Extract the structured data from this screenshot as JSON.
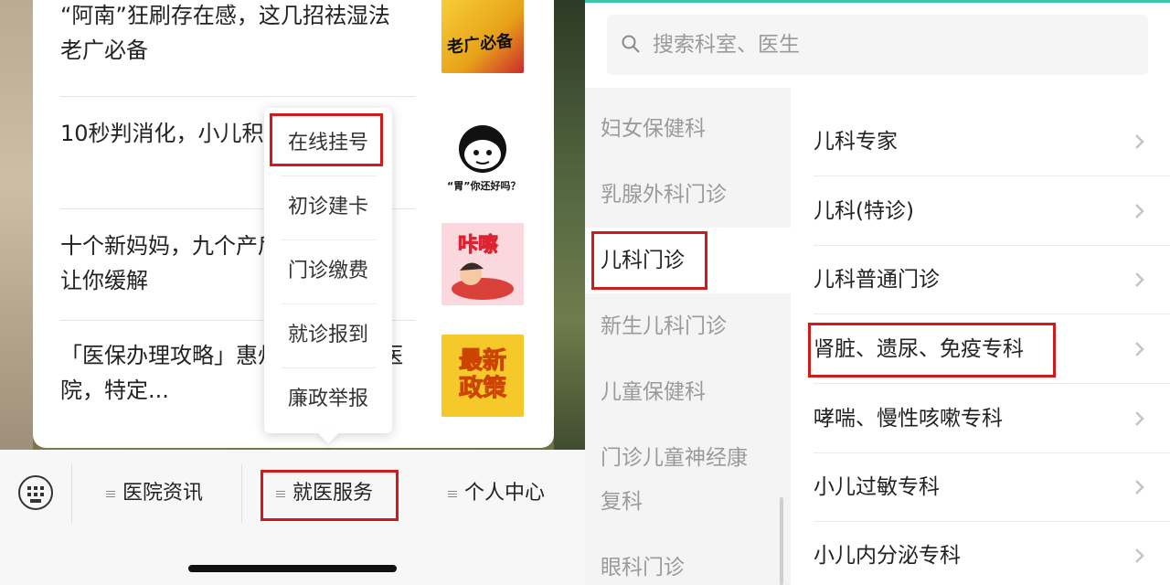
{
  "left": {
    "articles": [
      {
        "title": "“阿南”狂刷存在感，这几招祛湿法老广必备",
        "thumb_text": "老广必备"
      },
      {
        "title": "10秒判消化，小儿积食附食谱」",
        "thumb_text": "“胃”你还好吗？"
      },
      {
        "title": "十个新妈妈，九个产后做到这几点让你缓解",
        "thumb_text": "咔嚓"
      },
      {
        "title": "「医保办理攻略」惠州可定点2家医院，特定...",
        "thumb_text": "最新政策"
      }
    ],
    "popup_menu": [
      "在线挂号",
      "初诊建卡",
      "门诊缴费",
      "就诊报到",
      "廉政举报"
    ],
    "tabs": [
      "医院资讯",
      "就医服务",
      "个人中心"
    ]
  },
  "right": {
    "search_placeholder": "搜索科室、医生",
    "departments": [
      "妇女保健科",
      "乳腺外科门诊",
      "儿科门诊",
      "新生儿科门诊",
      "儿童保健科",
      "门诊儿童神经康",
      "复科",
      "眼科门诊"
    ],
    "active_department": "儿科门诊",
    "clinics": [
      "儿科专家",
      "儿科(特诊)",
      "儿科普通门诊",
      "肾脏、遗尿、免疫专科",
      "哮喘、慢性咳嗽专科",
      "小儿过敏专科",
      "小儿内分泌专科"
    ]
  },
  "colors": {
    "highlight": "#d11a1a",
    "accent": "#3fc5a8"
  }
}
